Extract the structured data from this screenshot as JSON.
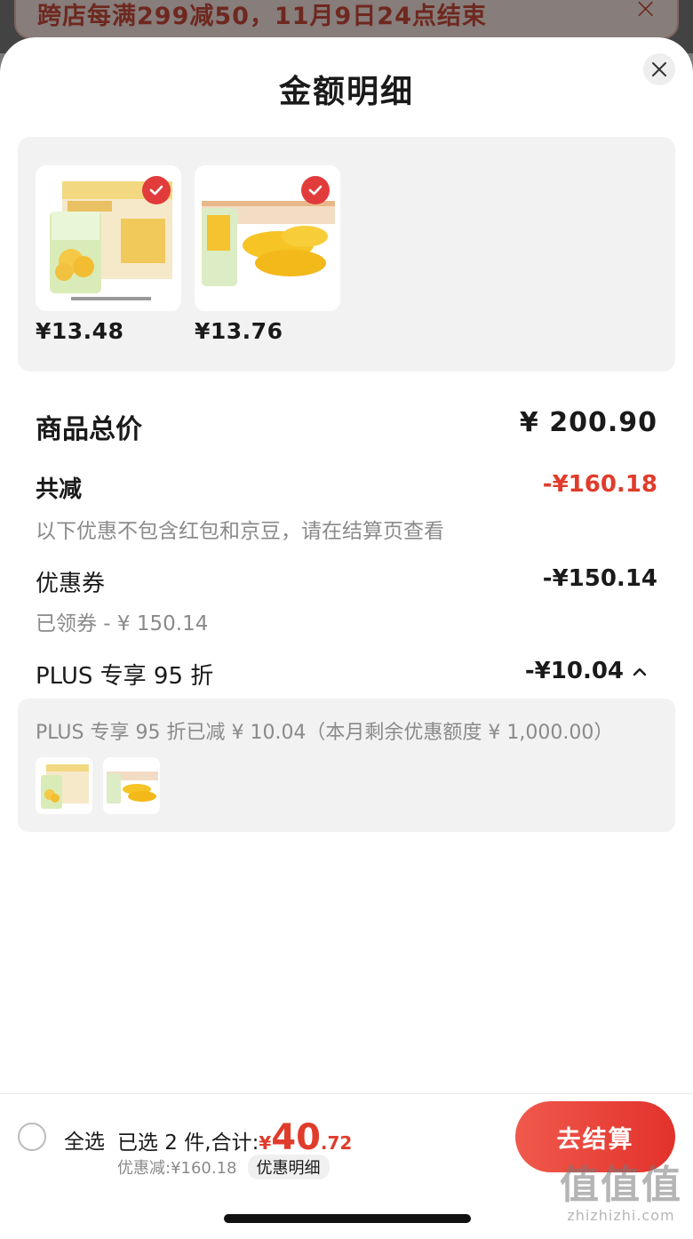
{
  "banner": {
    "text": "跨店每满299减50，11月9日24点结束"
  },
  "sheet": {
    "title": "金额明细"
  },
  "products": [
    {
      "price": "¥13.48"
    },
    {
      "price": "¥13.76"
    }
  ],
  "summary": {
    "total_label": "商品总价",
    "total_value": "¥ 200.90",
    "reduce_label": "共减",
    "reduce_value": "-¥160.18",
    "reduce_note": "以下优惠不包含红包和京豆，请在结算页查看",
    "coupon_label": "优惠券",
    "coupon_value": "-¥150.14",
    "coupon_note": "已领券 - ¥ 150.14",
    "plus_label": "PLUS 专享 95 折",
    "plus_value": "-¥10.04",
    "plus_note": "PLUS 专享 95 折已减 ¥ 10.04（本月剩余优惠额度 ¥ 1,000.00）"
  },
  "bottom": {
    "select_all": "全选",
    "selected_prefix": "已选 2 件,合计:",
    "yen": "¥",
    "total_int": "40",
    "total_dec": ".72",
    "discount_text": "优惠减:¥160.18",
    "detail_label": "优惠明细",
    "checkout_label": "去结算"
  },
  "watermark": {
    "big": "值值值",
    "small": "zhizhizhi.com"
  },
  "colors": {
    "accent": "#e03c2c",
    "checkout": "#e2322b"
  }
}
